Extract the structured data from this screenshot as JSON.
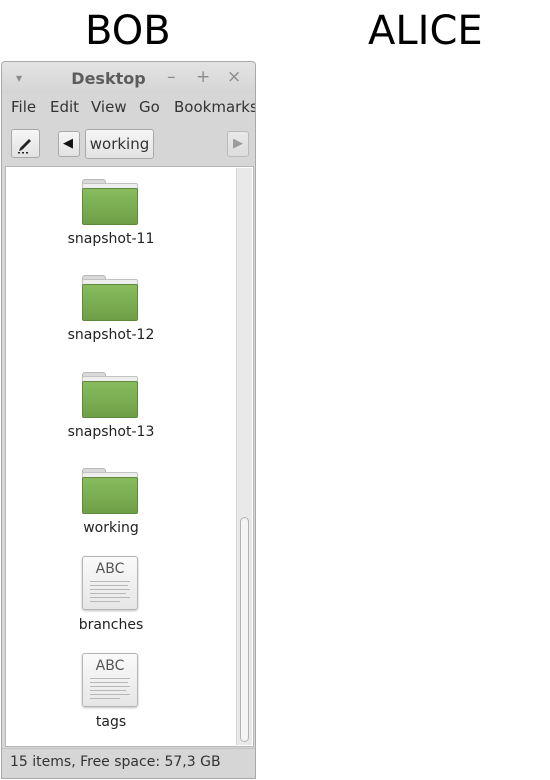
{
  "labels": {
    "left": "BOB",
    "right": "ALICE"
  },
  "window": {
    "title": "Desktop",
    "controls": {
      "menu": "▾",
      "minimize": "–",
      "maximize": "+",
      "close": "×"
    }
  },
  "menubar": {
    "items": [
      "File",
      "Edit",
      "View",
      "Go",
      "Bookmarks"
    ]
  },
  "toolbar": {
    "path_button": "working",
    "back_arrow": "◀",
    "forward_arrow": "▶",
    "edit_icon": "pencil-icon"
  },
  "files": [
    {
      "name": "snapshot-11",
      "type": "folder",
      "icon": "folder-icon"
    },
    {
      "name": "snapshot-12",
      "type": "folder",
      "icon": "folder-icon"
    },
    {
      "name": "snapshot-13",
      "type": "folder",
      "icon": "folder-icon"
    },
    {
      "name": "working",
      "type": "folder",
      "icon": "folder-icon"
    },
    {
      "name": "branches",
      "type": "text",
      "icon": "text-file-icon",
      "preview": "ABC"
    },
    {
      "name": "tags",
      "type": "text",
      "icon": "text-file-icon",
      "preview": "ABC"
    }
  ],
  "status": {
    "text": "15 items, Free space: 57,3 GB"
  },
  "colors": {
    "folder_green": "#7aab51",
    "window_bg": "#d6d6d6"
  }
}
